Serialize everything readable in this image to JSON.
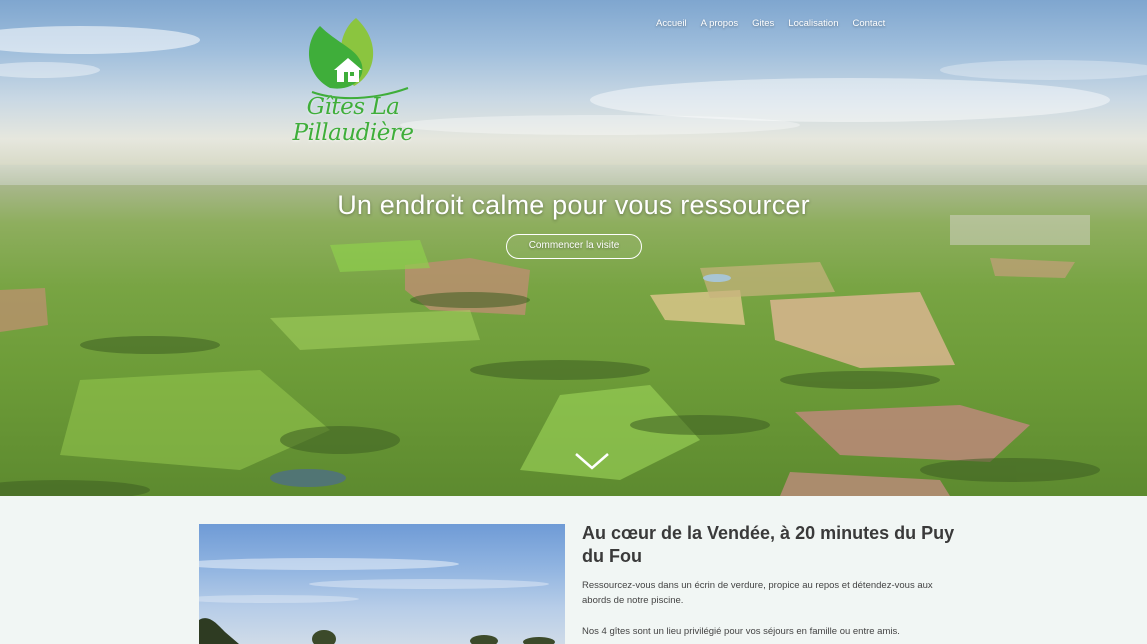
{
  "brand": {
    "name": "Gîtes La Pillaudière"
  },
  "nav": {
    "items": [
      {
        "label": "Accueil"
      },
      {
        "label": "A propos"
      },
      {
        "label": "Gites"
      },
      {
        "label": "Localisation"
      },
      {
        "label": "Contact"
      }
    ]
  },
  "hero": {
    "title": "Un endroit calme pour vous ressourcer",
    "cta_label": "Commencer la visite"
  },
  "intro": {
    "title": "Au cœur de la Vendée, à 20 minutes du Puy du Fou",
    "paragraph1": "Ressourcez-vous dans un écrin de verdure, propice au repos et détendez-vous aux abords de notre piscine.",
    "paragraph2": "Nos 4 gîtes sont un lieu privilégié pour vos séjours en famille ou entre amis."
  },
  "colors": {
    "brand_green": "#3fae3a",
    "accent_leaf": "#8bc53f",
    "page_bg": "#f1f6f4"
  },
  "icons": {
    "logo": "leaf-house-icon",
    "scroll": "chevron-down-icon"
  }
}
